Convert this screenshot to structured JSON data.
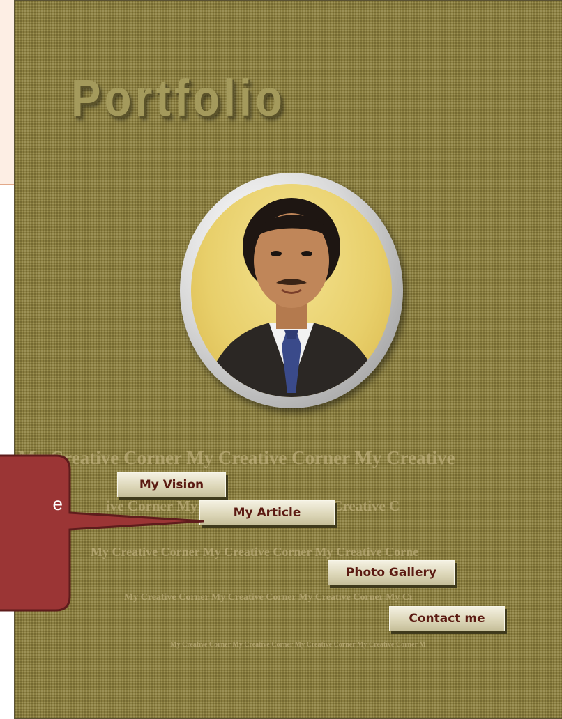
{
  "page": {
    "title": "Portfolio",
    "watermark_text": "My Creative Corner My Creative Corner My Creative",
    "watermark_line2": "ive Corner My Creative Corner My Creative C",
    "watermark_line3": "My Creative Corner My Creative Corner My Creative Corne",
    "watermark_line4": "My Creative Corner My Creative Corner My Creative Corner My Cr",
    "watermark_line5": "My Creative Corner My Creative Corner My Creative Corner My Creative Corner M"
  },
  "nav": {
    "vision_label": "My Vision",
    "article_label": "My Article",
    "gallery_label": "Photo Gallery",
    "contact_label": "Contact me"
  },
  "callout": {
    "text": "e"
  },
  "colors": {
    "background": "#8a7e40",
    "button_text": "#5b1a12",
    "callout_fill": "#9b3535",
    "header_band": "#fdeee4"
  }
}
